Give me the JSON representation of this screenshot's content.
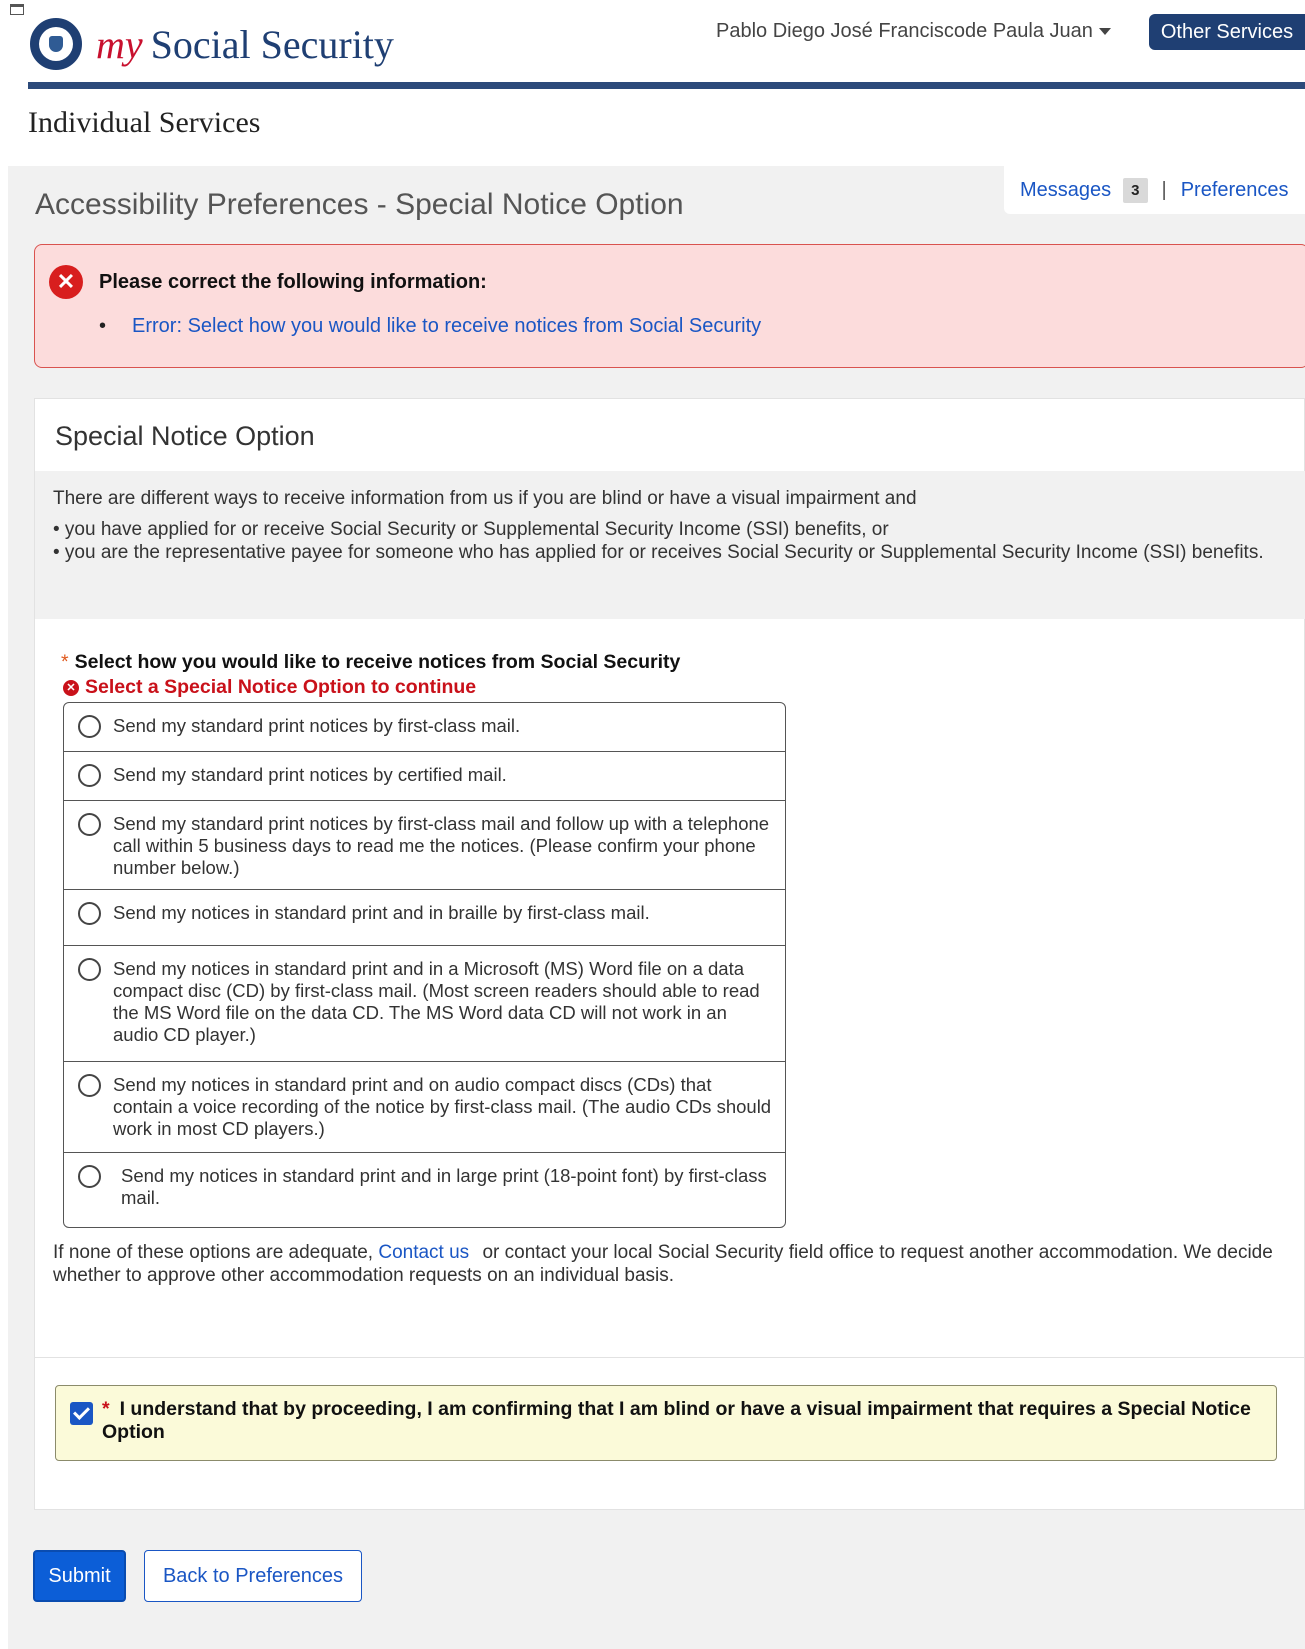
{
  "header": {
    "logo_my": "my",
    "logo_text": "Social Security",
    "user_name": "Pablo Diego José Franciscode Paula Juan",
    "other_services": "Other Services"
  },
  "section_heading": "Individual Services",
  "top_links": {
    "messages_label": "Messages",
    "messages_count": "3",
    "separator": "|",
    "preferences_label": "Preferences"
  },
  "page_title": "Accessibility Preferences - Special Notice Option",
  "error_summary": {
    "title": "Please correct the following information:",
    "items": [
      "Error: Select how you would like to receive notices from Social Security"
    ]
  },
  "card": {
    "title": "Special Notice Option",
    "intro": "There are different ways to receive information from us if you are blind or have a visual impairment and",
    "bullets": [
      "• you have applied for or receive Social Security or Supplemental Security Income (SSI) benefits, or",
      "• you are the representative payee for someone who has applied for or receives Social Security or Supplemental Security Income (SSI) benefits."
    ],
    "question_req": "*",
    "question": "Select how you would like to receive notices from Social Security",
    "field_error": "Select a Special Notice Option to continue",
    "options": [
      "Send my standard print notices by first-class mail.",
      "Send my standard print notices by certified mail.",
      "Send my standard print notices by first-class mail and follow up with a telephone call within 5 business days to read me the notices. (Please confirm your phone number below.)",
      "Send my notices in standard print and in braille by first-class mail.",
      "Send my notices in standard print and in a Microsoft (MS) Word file on a data compact disc (CD) by first-class mail. (Most screen readers should able to read the MS Word file on the data CD. The MS Word data CD will not work in an audio CD player.)",
      "Send my notices in standard print and on audio compact discs (CDs) that contain a voice recording of the notice by first-class mail.  (The audio CDs should work in most CD players.)",
      "Send my notices in standard print and in large print (18-point font) by first-class mail."
    ],
    "footnote_before": "If none of these options are adequate,",
    "footnote_link": "Contact us",
    "footnote_after": "or contact your local Social Security field office to request another accommodation. We decide whether to approve other accommodation requests on an individual basis.",
    "confirm_req": "*",
    "confirm_text": "I understand that by proceeding, I am confirming that I am blind or have a visual impairment that requires a Special Notice Option",
    "confirm_checked": true
  },
  "buttons": {
    "submit": "Submit",
    "back": "Back to Preferences"
  },
  "colors": {
    "brand_navy": "#1f3f73",
    "link_blue": "#1a56c4",
    "error_red": "#c9111a",
    "error_bg": "#fcdcdc",
    "confirm_bg": "#fbfad9"
  }
}
